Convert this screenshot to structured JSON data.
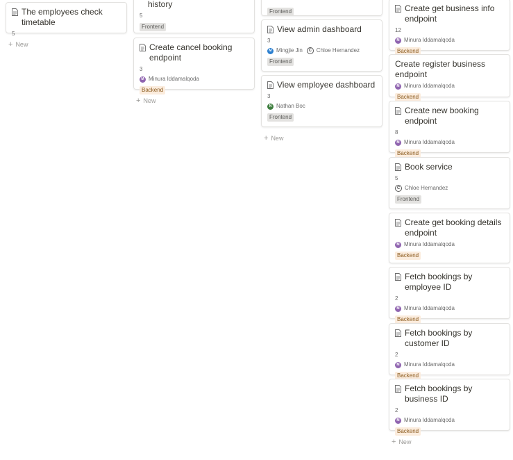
{
  "new_label": "New",
  "colors": {
    "purple": "#9065b0",
    "blue": "#2b7fcf",
    "green": "#3f7f3f",
    "outline": "#555555"
  },
  "col1": {
    "card1": {
      "title": "The employees check timetable",
      "num": "5"
    }
  },
  "col2": {
    "card1": {
      "title": "history",
      "num": "5",
      "tag": "Frontend"
    },
    "card2": {
      "title": "Create cancel booking endpoint",
      "num": "3",
      "person": "Minura Iddamalqoda",
      "initial": "M",
      "tag": "Backend"
    }
  },
  "col3": {
    "card1": {
      "tag": "Frontend"
    },
    "card2": {
      "title": "View admin dashboard",
      "num": "3",
      "person1": "Mingjie Jin",
      "initial1": "M",
      "person2": "Chloe Hernandez",
      "initial2": "C",
      "tag": "Frontend"
    },
    "card3": {
      "title": "View employee dashboard",
      "num": "3",
      "person": "Nathan Boc",
      "initial": "N",
      "tag": "Frontend"
    }
  },
  "col4": {
    "cards": [
      {
        "title": "Create get business info endpoint",
        "num": "12",
        "person": "Minura Iddamalqoda",
        "initial": "M",
        "tag": "Backend"
      },
      {
        "title": "Create register business endpoint",
        "person": "Minura Iddamalqoda",
        "initial": "M",
        "tag": "Backend"
      },
      {
        "title": "Create new booking endpoint",
        "num": "8",
        "person": "Minura Iddamalqoda",
        "initial": "M",
        "tag": "Backend"
      },
      {
        "title": "Book service",
        "num": "5",
        "person": "Chloe Hernandez",
        "initial": "C",
        "tag": "Frontend"
      },
      {
        "title": "Create get booking details endpoint",
        "person": "Minura Iddamalqoda",
        "initial": "M",
        "tag": "Backend"
      },
      {
        "title": "Fetch bookings by employee ID",
        "num": "2",
        "person": "Minura Iddamalqoda",
        "initial": "M",
        "tag": "Backend"
      },
      {
        "title": "Fetch bookings by customer ID",
        "num": "2",
        "person": "Minura Iddamalqoda",
        "initial": "M",
        "tag": "Backend"
      },
      {
        "title": "Fetch bookings by business ID",
        "num": "2",
        "person": "Minura Iddamalqoda",
        "initial": "M",
        "tag": "Backend"
      }
    ]
  }
}
